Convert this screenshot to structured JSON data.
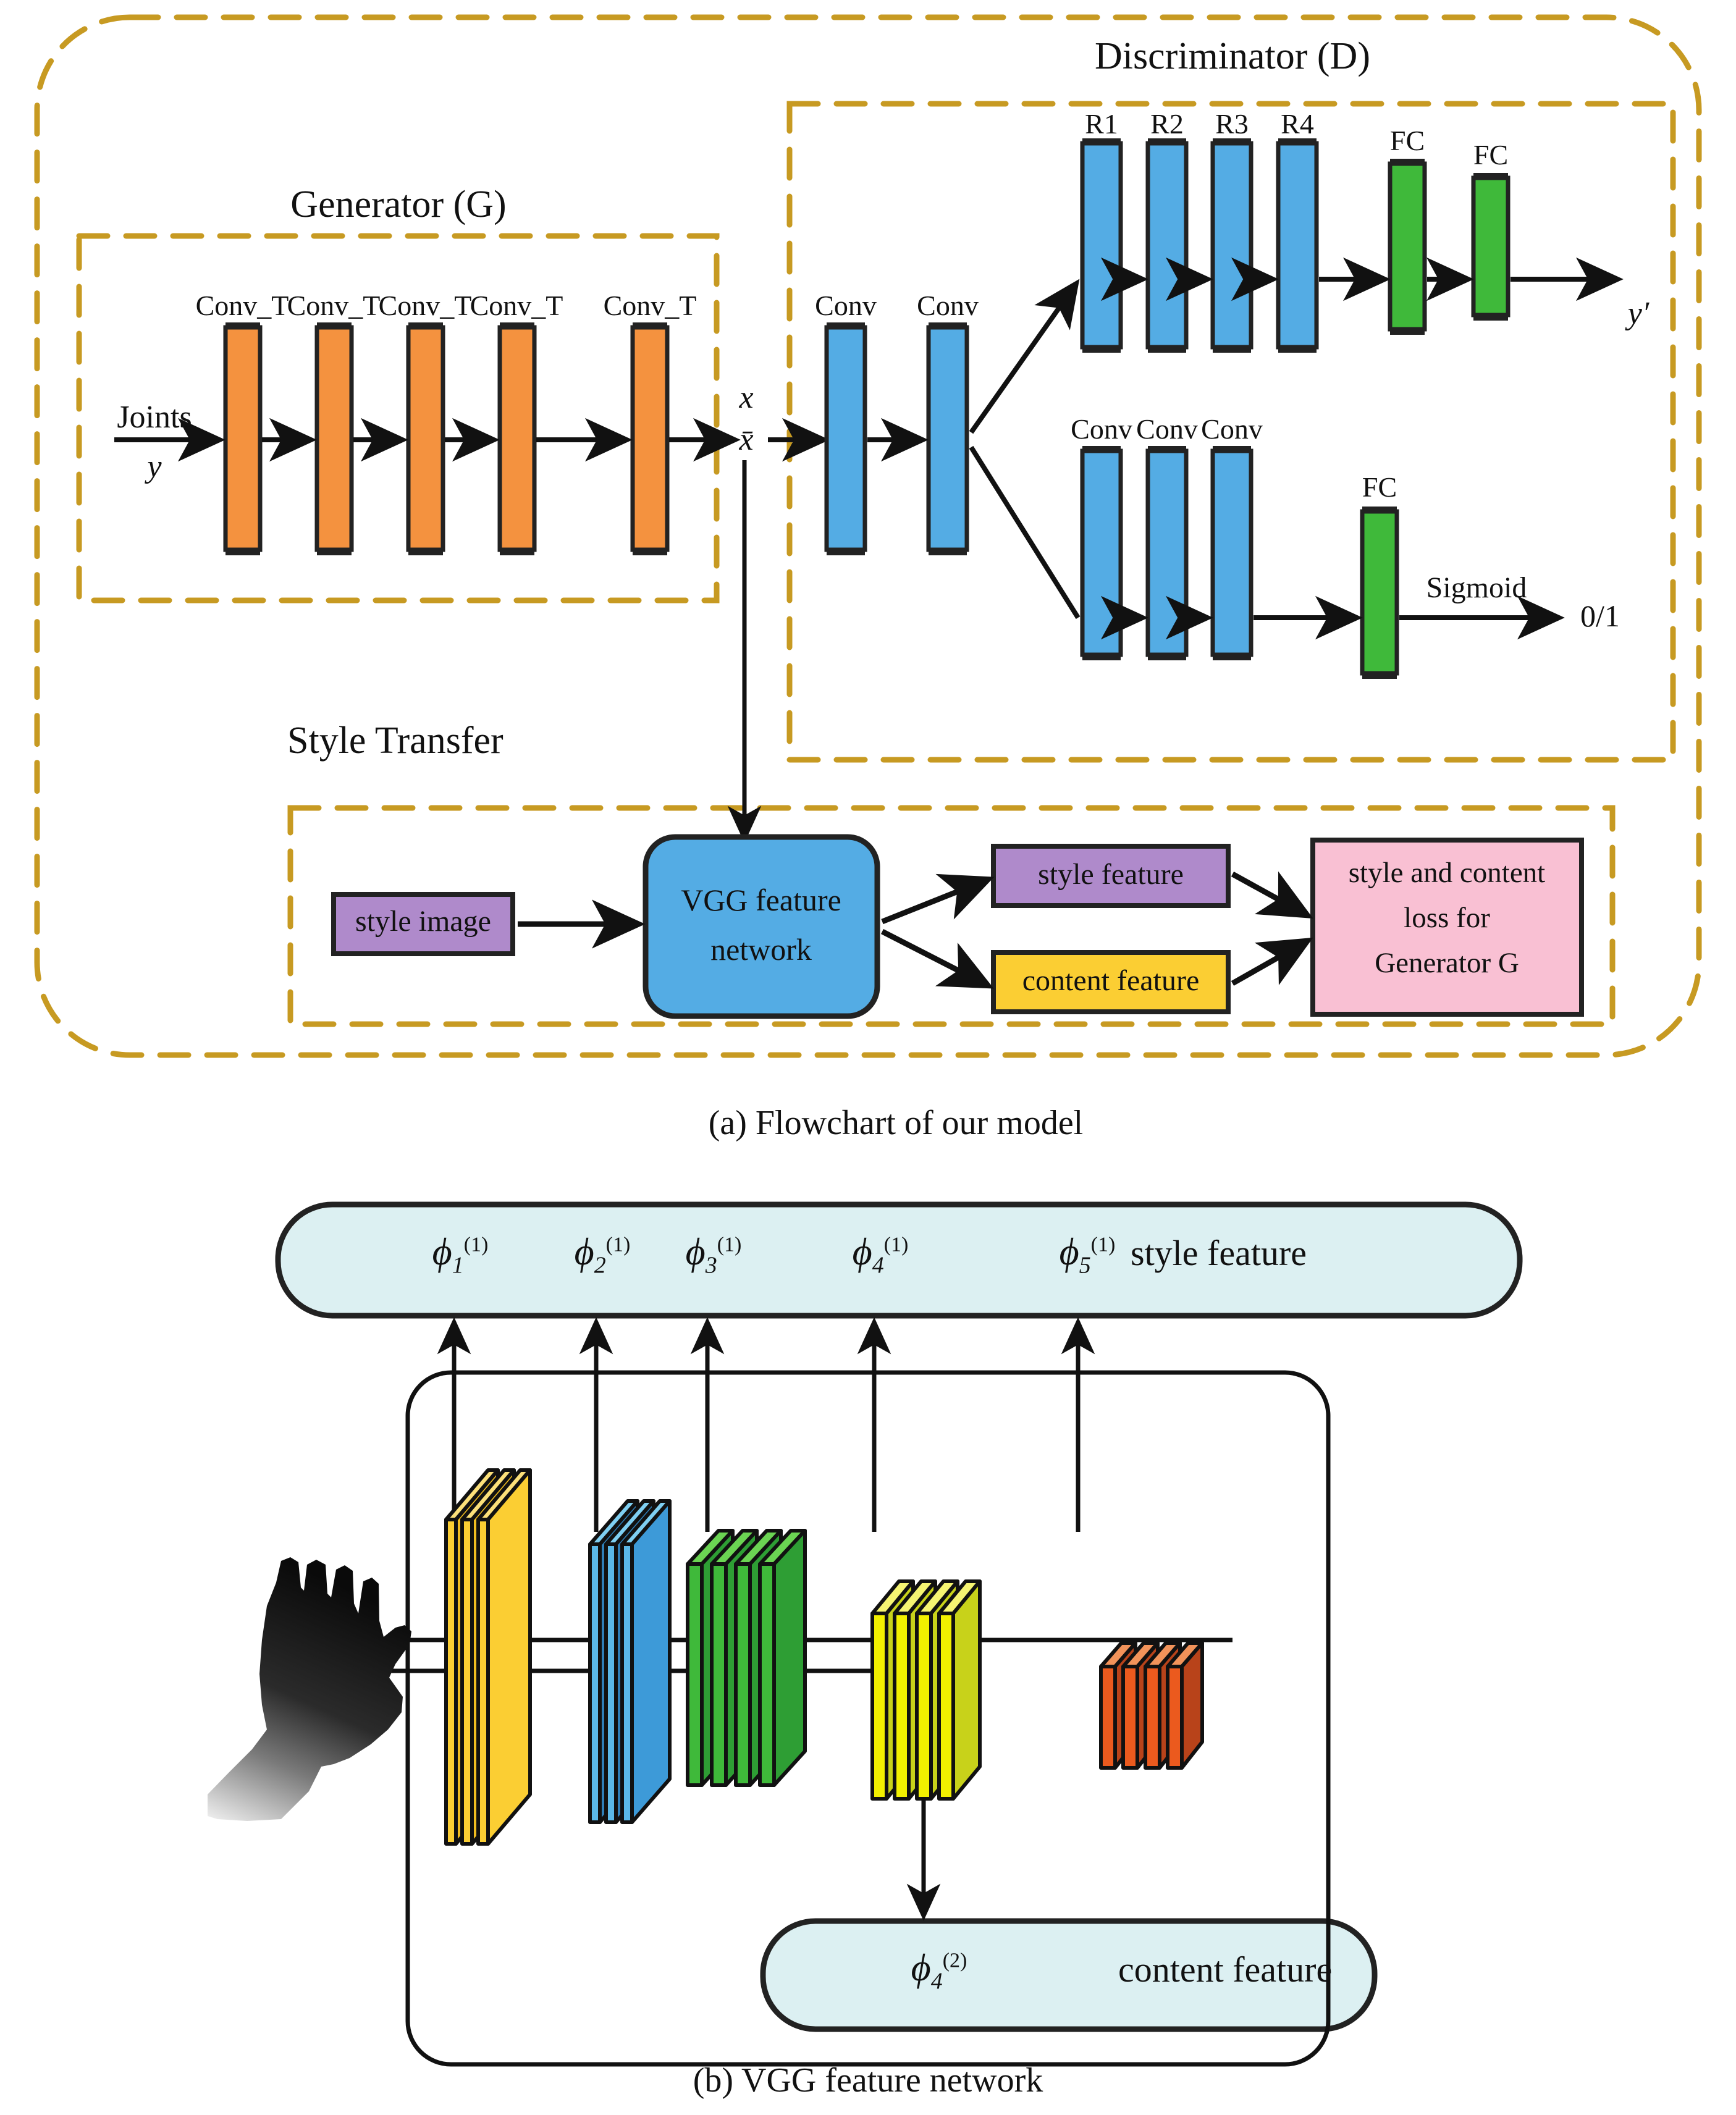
{
  "figure": {
    "caption_a": "(a) Flowchart of our model",
    "caption_b": "(b) VGG feature network"
  },
  "panel_a": {
    "generator": {
      "title": "Generator (G)",
      "input_label": "Joints",
      "input_symbol": "y",
      "layers": [
        {
          "label": "Conv_T",
          "color": "#F4923F"
        },
        {
          "label": "Conv_T",
          "color": "#F4923F"
        },
        {
          "label": "Conv_T",
          "color": "#F4923F"
        },
        {
          "label": "Conv_T",
          "color": "#F4923F"
        },
        {
          "label": "Conv_T",
          "color": "#F4923F"
        }
      ],
      "output_symbol_top": "x",
      "output_symbol_bottom": "x̄"
    },
    "discriminator": {
      "title": "Discriminator (D)",
      "shared_conv": [
        {
          "label": "Conv",
          "color": "#54ACE4"
        },
        {
          "label": "Conv",
          "color": "#54ACE4"
        }
      ],
      "branch_pose": {
        "blocks": [
          {
            "label": "R1",
            "color": "#54ACE4"
          },
          {
            "label": "R2",
            "color": "#54ACE4"
          },
          {
            "label": "R3",
            "color": "#54ACE4"
          },
          {
            "label": "R4",
            "color": "#54ACE4"
          },
          {
            "label": "FC",
            "color": "#3FB93A"
          },
          {
            "label": "FC",
            "color": "#3FB93A"
          }
        ],
        "output_symbol": "y′"
      },
      "branch_real_fake": {
        "blocks": [
          {
            "label": "Conv",
            "color": "#54ACE4"
          },
          {
            "label": "Conv",
            "color": "#54ACE4"
          },
          {
            "label": "Conv",
            "color": "#54ACE4"
          },
          {
            "label": "FC",
            "color": "#3FB93A"
          }
        ],
        "activation": "Sigmoid",
        "output_symbol": "0/1"
      }
    },
    "style_transfer": {
      "title": "Style Transfer",
      "style_image_box": "style image",
      "vgg_box_line1": "VGG feature",
      "vgg_box_line2": "network",
      "style_feature_box": "style feature",
      "content_feature_box": "content feature",
      "loss_box_line1": "style and content",
      "loss_box_line2": "loss for",
      "loss_box_line3": "Generator G"
    },
    "colors": {
      "dashed_border": "#C79A22",
      "orange": "#F4923F",
      "blue": "#54ACE4",
      "green": "#3FB93A",
      "purple": "#AF8ACB",
      "yellow": "#FBCE33",
      "pink": "#F9C0D3",
      "outline": "#222222"
    }
  },
  "panel_b": {
    "style_feature_bar": {
      "label": "style feature",
      "symbols": [
        {
          "base": "ϕ",
          "sub": "1",
          "sup": "(1)"
        },
        {
          "base": "ϕ",
          "sub": "2",
          "sup": "(1)"
        },
        {
          "base": "ϕ",
          "sub": "3",
          "sup": "(1)"
        },
        {
          "base": "ϕ",
          "sub": "4",
          "sup": "(1)"
        },
        {
          "base": "ϕ",
          "sub": "5",
          "sup": "(1)"
        }
      ],
      "fill": "#DCF0F2"
    },
    "content_feature_bar": {
      "label": "content feature",
      "symbol": {
        "base": "ϕ",
        "sub": "4",
        "sup": "(2)"
      },
      "fill": "#DCF0F2"
    },
    "input_image": "hand-depth-image",
    "vgg_groups": [
      {
        "name": "group-1",
        "count": 2,
        "face": "#FBCE33",
        "top": "#FCE07A",
        "side": "#F0BC20"
      },
      {
        "name": "group-2",
        "count": 2,
        "face": "#3D9AD8",
        "top": "#7FCFF2",
        "side": "#2F7FB8"
      },
      {
        "name": "group-3",
        "count": 4,
        "face": "#3FB93A",
        "top": "#6BD453",
        "side": "#2E9E34"
      },
      {
        "name": "group-4",
        "count": 4,
        "face": "#F2F000",
        "top": "#F5F472",
        "side": "#C8D21A"
      },
      {
        "name": "group-5",
        "count": 4,
        "face": "#EB5A1E",
        "top": "#F2935A",
        "side": "#B8431A"
      }
    ]
  }
}
